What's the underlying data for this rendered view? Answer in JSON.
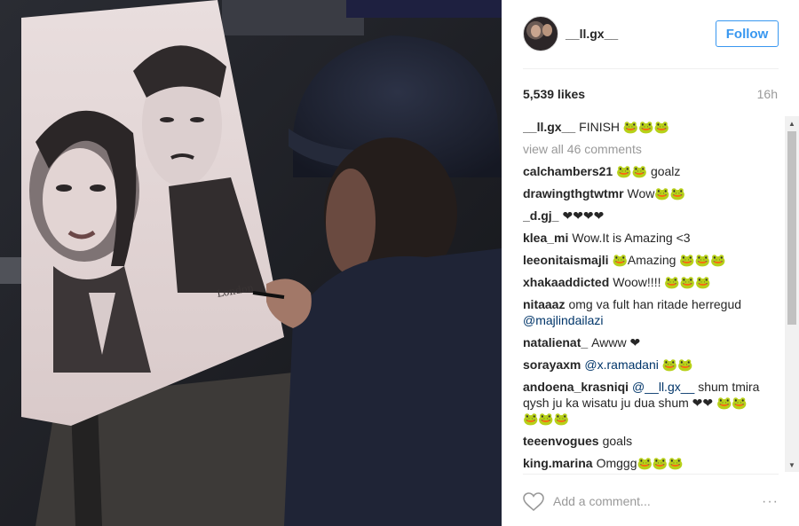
{
  "post": {
    "username": "__ll.gx__",
    "follow_label": "Follow",
    "likes": "5,539 likes",
    "time": "16h",
    "caption": {
      "user": "__ll.gx__",
      "text": "FINISH 🐸🐸🐸"
    },
    "view_all": "view all 46 comments",
    "comments": [
      {
        "user": "calchambers21",
        "text": "🐸🐸 goalz"
      },
      {
        "user": "drawingthgtwtmr",
        "text": "Wow🐸🐸"
      },
      {
        "user": "_d.gj_",
        "text": "❤❤❤❤"
      },
      {
        "user": "klea_mi",
        "text": "Wow.It is Amazing <3"
      },
      {
        "user": "leeonitaismajli",
        "text": "🐸Amazing 🐸🐸🐸"
      },
      {
        "user": "xhakaaddicted",
        "text": "Woow!!!! 🐸🐸🐸"
      },
      {
        "user": "nitaaaz",
        "text": "omg va fult han ritade herregud",
        "mention": "@majlindailazi",
        "text_after": ""
      },
      {
        "user": "natalienat_",
        "text": "Awww ❤"
      },
      {
        "user": "sorayaxm",
        "text": "",
        "mention": "@x.ramadani",
        "text_after": " 🐸🐸"
      },
      {
        "user": "andoena_krasniqi",
        "text": "",
        "mention": "@__ll.gx__",
        "text_after": " shum tmira qysh ju ka wisatu ju dua shum ❤❤ 🐸🐸🐸🐸🐸"
      },
      {
        "user": "teeenvogues",
        "text": "goals"
      },
      {
        "user": "king.marina",
        "text": "Omggg🐸🐸🐸"
      }
    ],
    "add_comment_placeholder": "Add a comment...",
    "more_label": "···"
  },
  "colors": {
    "accent": "#3897f0",
    "muted": "#999999",
    "mention": "#003569"
  },
  "icons": {
    "like": "heart-outline-icon",
    "more": "ellipsis-icon"
  }
}
